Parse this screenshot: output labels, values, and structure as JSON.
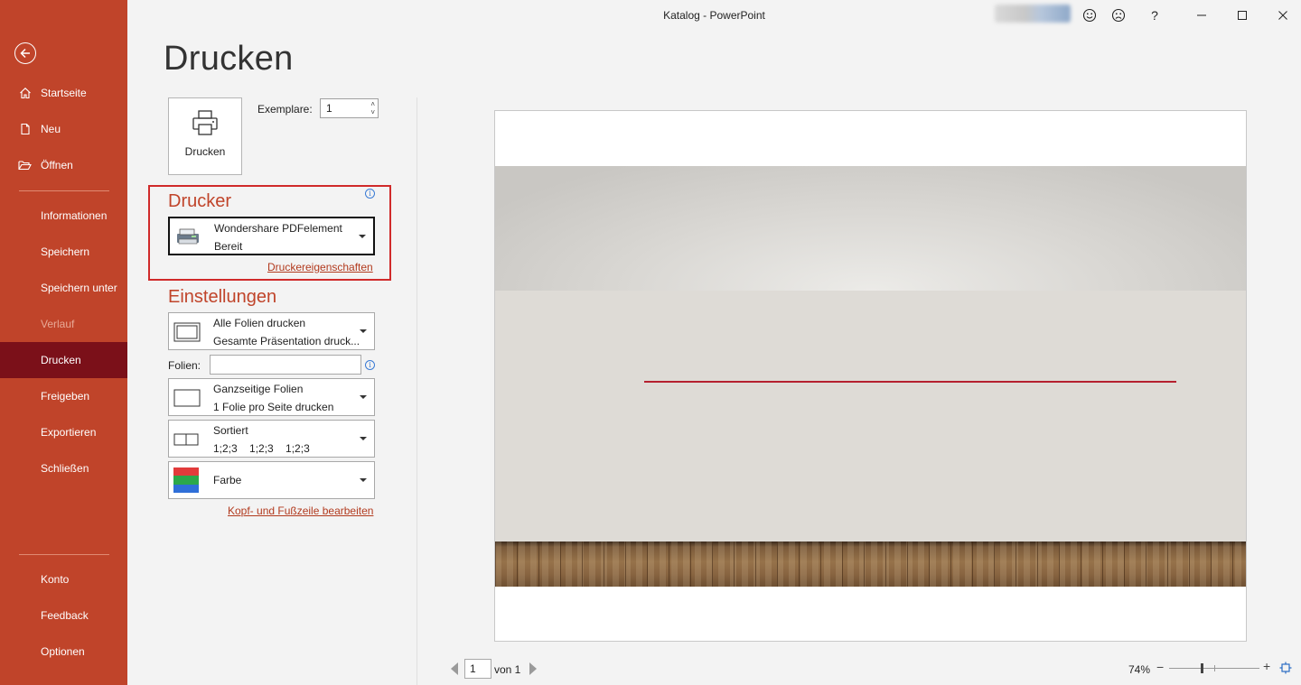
{
  "window": {
    "title": "Katalog  -  PowerPoint",
    "controls": [
      "smiley-icon",
      "frown-icon",
      "help-icon",
      "minimize-icon",
      "maximize-icon",
      "close-icon"
    ],
    "help_label": "?"
  },
  "sidebar": {
    "back_icon": "back-arrow-icon",
    "items_top": [
      {
        "label": "Startseite",
        "icon": "home-icon"
      },
      {
        "label": "Neu",
        "icon": "new-document-icon"
      },
      {
        "label": "Öffnen",
        "icon": "folder-open-icon"
      }
    ],
    "items_mid": [
      {
        "label": "Informationen"
      },
      {
        "label": "Speichern"
      },
      {
        "label": "Speichern unter"
      },
      {
        "label": "Verlauf",
        "disabled": true
      },
      {
        "label": "Drucken",
        "active": true
      },
      {
        "label": "Freigeben"
      },
      {
        "label": "Exportieren"
      },
      {
        "label": "Schließen"
      }
    ],
    "items_bottom": [
      {
        "label": "Konto"
      },
      {
        "label": "Feedback"
      },
      {
        "label": "Optionen"
      }
    ]
  },
  "print": {
    "heading": "Drucken",
    "button_label": "Drucken",
    "copies_label": "Exemplare:",
    "copies_value": "1",
    "printer_section": "Drucker",
    "printer_name": "Wondershare PDFelement",
    "printer_status": "Bereit",
    "printer_properties_link": "Druckereigenschaften",
    "settings_section": "Einstellungen",
    "slides_range_l1": "Alle Folien drucken",
    "slides_range_l2": "Gesamte Präsentation druck...",
    "slides_label": "Folien:",
    "slides_value": "",
    "layout_l1": "Ganzseitige Folien",
    "layout_l2": "1 Folie pro Seite drucken",
    "collate_l1": "Sortiert",
    "collate_l2": "1;2;3    1;2;3    1;2;3",
    "color_l1": "Farbe",
    "header_footer_link": "Kopf- und Fußzeile bearbeiten"
  },
  "preview": {
    "page_value": "1",
    "page_of": "von 1",
    "zoom": "74%",
    "zoom_minus": "−",
    "zoom_plus": "+",
    "accent_line_color": "#b5202f"
  },
  "colors": {
    "sidebar_bg": "#c0442a",
    "sidebar_active": "#7b1019",
    "accent": "#c0442a",
    "highlight_border": "#d02a2a"
  }
}
